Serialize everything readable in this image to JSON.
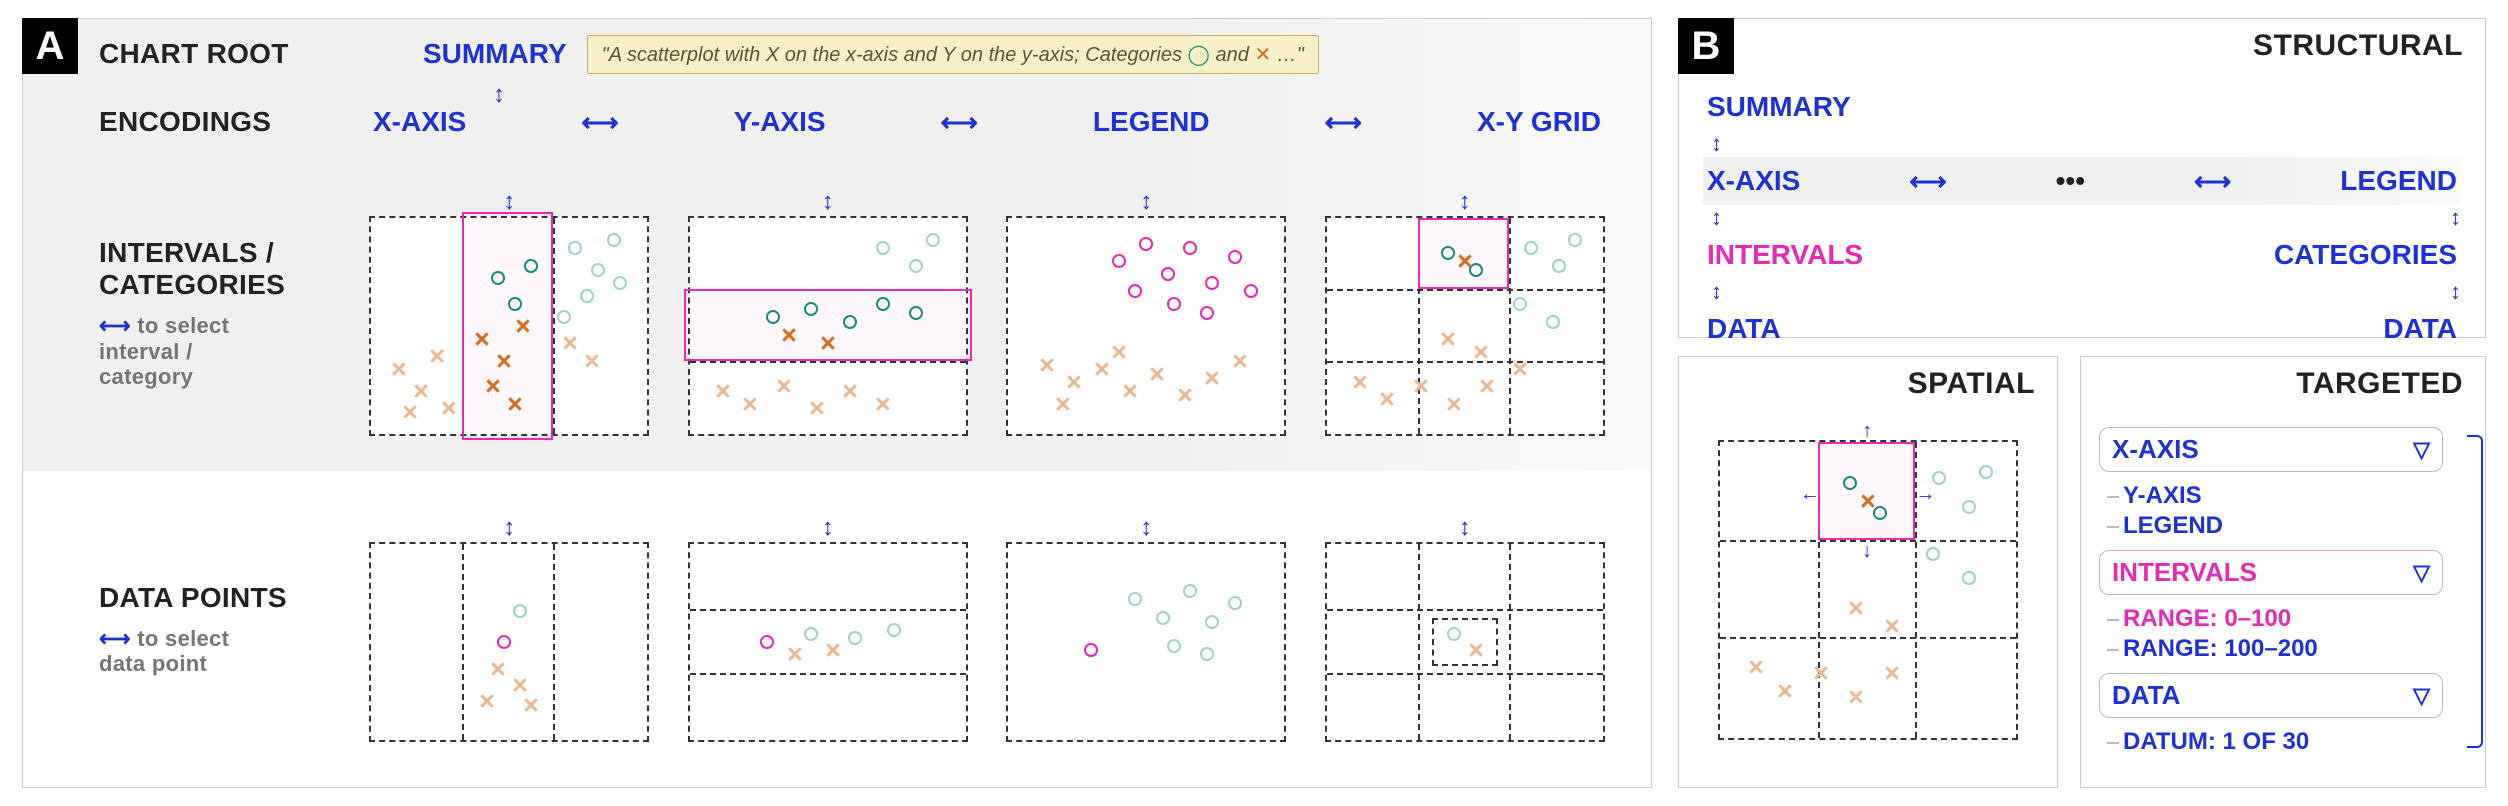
{
  "panelA": {
    "badge": "A",
    "rows": {
      "root_label": "CHART ROOT",
      "enc_label": "ENCODINGS",
      "int_label1": "INTERVALS /",
      "int_label2": "CATEGORIES",
      "int_hint_arrow": "⟷",
      "int_hint1": "to select",
      "int_hint2": "interval /",
      "int_hint3": "category",
      "dp_label": "DATA POINTS",
      "dp_hint_arrow": "⟷",
      "dp_hint1": "to select",
      "dp_hint2": "data point"
    },
    "summary_node": "SUMMARY",
    "encodings": {
      "x": "X-AXIS",
      "y": "Y-AXIS",
      "legend": "LEGEND",
      "grid": "X-Y GRID"
    },
    "caption": {
      "prefix": "\"A scatterplot with X on the x-axis and Y on the y-axis; Categories ",
      "mid": " and ",
      "suffix": " …\""
    }
  },
  "panelB": {
    "badge": "B",
    "title": "STRUCTURAL",
    "nodes": {
      "summary": "SUMMARY",
      "xaxis": "X-AXIS",
      "dots": "•••",
      "legend": "LEGEND",
      "intervals": "INTERVALS",
      "categories": "CATEGORIES",
      "data1": "DATA",
      "data2": "DATA"
    }
  },
  "spatial_title": "SPATIAL",
  "targeted": {
    "title": "TARGETED",
    "xaxis": "X-AXIS",
    "yaxis": "Y-AXIS",
    "legend": "LEGEND",
    "intervals": "INTERVALS",
    "range1": "RANGE: 0–100",
    "range2": "RANGE: 100–200",
    "data": "DATA",
    "datum": "DATUM: 1 OF 30"
  },
  "arrows": {
    "h": "⟷",
    "v": "↕"
  }
}
